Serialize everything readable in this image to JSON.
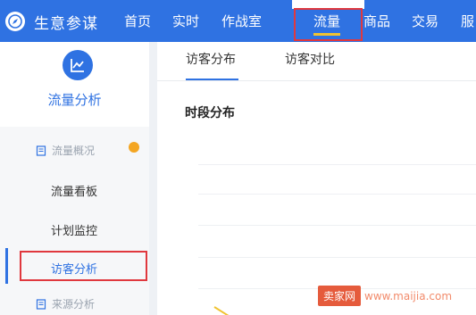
{
  "app": {
    "brand_name": "生意参谋"
  },
  "topnav": {
    "items": [
      {
        "label": "首页"
      },
      {
        "label": "实时"
      },
      {
        "label": "作战室"
      },
      {
        "label": "流量"
      },
      {
        "label": "商品"
      },
      {
        "label": "交易"
      },
      {
        "label": "服"
      }
    ],
    "active": "流量"
  },
  "sidebar": {
    "title": "流量分析",
    "groups": [
      {
        "label": "流量概况"
      },
      {
        "label": "来源分析"
      }
    ],
    "items": [
      {
        "label": "流量看板"
      },
      {
        "label": "计划监控"
      },
      {
        "label": "访客分析"
      }
    ],
    "active_item": "访客分析"
  },
  "main": {
    "tabs": [
      {
        "label": "访客分布"
      },
      {
        "label": "访客对比"
      }
    ],
    "active_tab": "访客分布",
    "section_title": "时段分布"
  },
  "watermark": {
    "badge": "卖家网",
    "url": "www.maijia.com"
  },
  "colors": {
    "primary": "#2f72e2",
    "highlight_red": "#e0383e",
    "badge_orange": "#f4a623",
    "underline_yellow": "#f0c331"
  }
}
